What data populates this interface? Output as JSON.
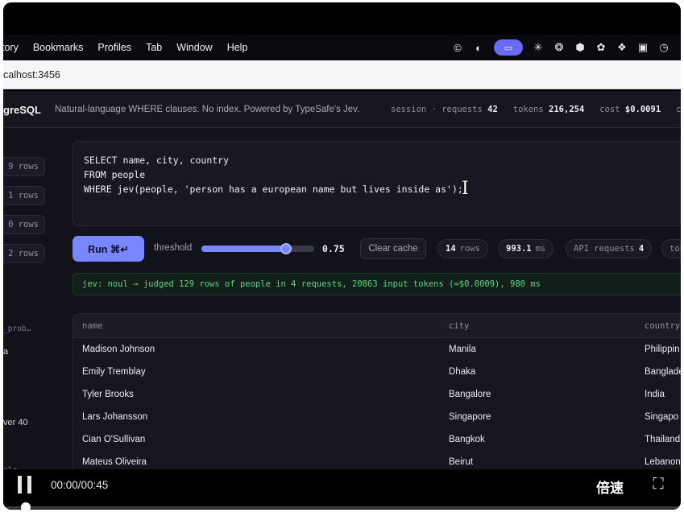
{
  "menubar": {
    "items": [
      "tory",
      "Bookmarks",
      "Profiles",
      "Tab",
      "Window",
      "Help"
    ],
    "tray_icons": [
      "c-circle-icon",
      "half-circle-icon",
      "screen-share-icon",
      "asterisk-icon",
      "openai-icon",
      "cube-icon",
      "flower-icon",
      "figma-icon",
      "badge-icon",
      "timer-icon"
    ]
  },
  "address_bar": {
    "url": "calhost:3456"
  },
  "app": {
    "brand": "greSQL",
    "tagline": "Natural-language WHERE clauses. No index. Powered by TypeSafe's Jev.",
    "stats": {
      "session": "session",
      "requests_label": "requests",
      "requests_value": "42",
      "tokens_label": "tokens",
      "tokens_value": "216,254",
      "cost_label": "cost",
      "cost_value": "$0.0091",
      "cut": "ca"
    }
  },
  "sidebar": {
    "chips": [
      "9 rows",
      "1 rows",
      "0 rows",
      "2 rows"
    ],
    "labels": [
      "_prob…",
      "a",
      "ver 40",
      "ale, ~"
    ]
  },
  "editor": {
    "lines": [
      "SELECT name, city, country",
      "FROM people",
      "WHERE jev(people, 'person has a european name but lives inside as');"
    ]
  },
  "controls": {
    "run_label": "Run ⌘↵",
    "threshold_label": "threshold",
    "threshold_value": "0.75",
    "threshold_fraction": 0.75,
    "clear_cache_label": "Clear cache",
    "rows_value": "14",
    "rows_label": "rows",
    "time_value": "993.1",
    "time_label": "ms",
    "api_label": "API requests",
    "api_value": "4",
    "tokens_cut": "tok"
  },
  "log": {
    "text": "jev: noul → judged 129 rows of people in 4 requests, 20863 input tokens (≈$0.0009), 980 ms"
  },
  "table": {
    "headers": [
      "name",
      "city",
      "country"
    ],
    "rows": [
      [
        "Madison Johnson",
        "Manila",
        "Philippin"
      ],
      [
        "Emily Tremblay",
        "Dhaka",
        "Banglade"
      ],
      [
        "Tyler Brooks",
        "Bangalore",
        "India"
      ],
      [
        "Lars Johansson",
        "Singapore",
        "Singapo"
      ],
      [
        "Cian O'Sullivan",
        "Bangkok",
        "Thailand"
      ],
      [
        "Mateus Oliveira",
        "Beirut",
        "Lebanon"
      ]
    ]
  },
  "video": {
    "time": "00:00/00:45",
    "speed_label": "倍速",
    "progress_fraction": 0.0
  }
}
